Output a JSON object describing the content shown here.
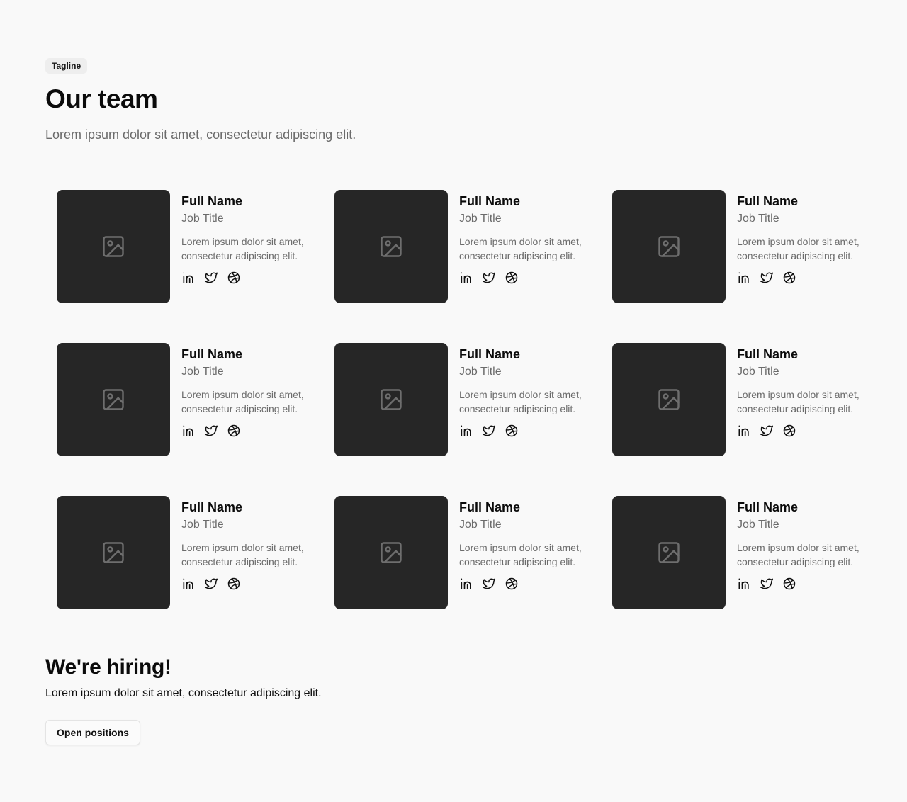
{
  "header": {
    "tagline": "Tagline",
    "title": "Our team",
    "subtitle": "Lorem ipsum dolor sit amet, consectetur adipiscing elit."
  },
  "members": [
    {
      "name": "Full Name",
      "job_title": "Job Title",
      "bio": "Lorem ipsum dolor sit amet, consectetur adipiscing elit."
    },
    {
      "name": "Full Name",
      "job_title": "Job Title",
      "bio": "Lorem ipsum dolor sit amet, consectetur adipiscing elit."
    },
    {
      "name": "Full Name",
      "job_title": "Job Title",
      "bio": "Lorem ipsum dolor sit amet, consectetur adipiscing elit."
    },
    {
      "name": "Full Name",
      "job_title": "Job Title",
      "bio": "Lorem ipsum dolor sit amet, consectetur adipiscing elit."
    },
    {
      "name": "Full Name",
      "job_title": "Job Title",
      "bio": "Lorem ipsum dolor sit amet, consectetur adipiscing elit."
    },
    {
      "name": "Full Name",
      "job_title": "Job Title",
      "bio": "Lorem ipsum dolor sit amet, consectetur adipiscing elit."
    },
    {
      "name": "Full Name",
      "job_title": "Job Title",
      "bio": "Lorem ipsum dolor sit amet, consectetur adipiscing elit."
    },
    {
      "name": "Full Name",
      "job_title": "Job Title",
      "bio": "Lorem ipsum dolor sit amet, consectetur adipiscing elit."
    },
    {
      "name": "Full Name",
      "job_title": "Job Title",
      "bio": "Lorem ipsum dolor sit amet, consectetur adipiscing elit."
    }
  ],
  "member_icons": {
    "photo": "image-placeholder-icon",
    "socials": [
      "linkedin-icon",
      "twitter-icon",
      "dribbble-icon"
    ]
  },
  "hiring": {
    "title": "We're hiring!",
    "text": "Lorem ipsum dolor sit amet, consectetur adipiscing elit.",
    "button_label": "Open positions"
  },
  "colors": {
    "background": "#f9f9f9",
    "photo_placeholder": "#262626",
    "muted_text": "#6b6b6b",
    "tagline_bg": "#eeeeee"
  }
}
